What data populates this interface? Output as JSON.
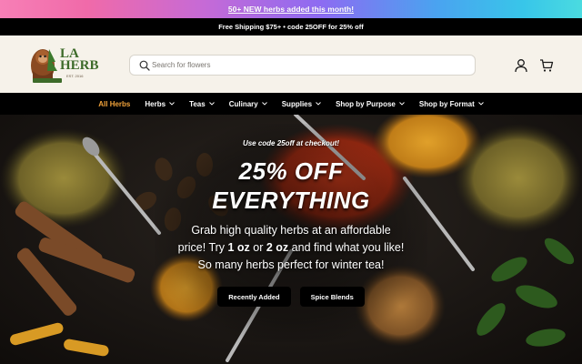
{
  "promo": {
    "text": "50+ NEW herbs added this month!"
  },
  "shipping": {
    "text": "Free Shipping $75+ • code 25OFF for 25% off"
  },
  "logo": {
    "line1": "LA",
    "line2": "HERB",
    "tag": "EST. 2016"
  },
  "search": {
    "placeholder": "Search for flowers"
  },
  "nav": {
    "items": [
      {
        "label": "All Herbs",
        "active": true,
        "dropdown": false
      },
      {
        "label": "Herbs",
        "active": false,
        "dropdown": true
      },
      {
        "label": "Teas",
        "active": false,
        "dropdown": true
      },
      {
        "label": "Culinary",
        "active": false,
        "dropdown": true
      },
      {
        "label": "Supplies",
        "active": false,
        "dropdown": true
      },
      {
        "label": "Shop by Purpose",
        "active": false,
        "dropdown": true
      },
      {
        "label": "Shop by Format",
        "active": false,
        "dropdown": true
      }
    ]
  },
  "hero": {
    "kicker": "Use code 25off at checkout!",
    "title_line1": "25% OFF",
    "title_line2": "EVERYTHING",
    "body_part1": "Grab high quality herbs at an affordable price! Try ",
    "body_bold1": "1 oz",
    "body_part2": " or ",
    "body_bold2": "2 oz",
    "body_part3": " and find what you like! So many herbs perfect for winter tea!",
    "button1": "Recently Added",
    "button2": "Spice Blends"
  },
  "colors": {
    "accent": "#f2a33a",
    "header_bg": "#f6f2ea",
    "nav_bg": "#000000"
  },
  "icons": {
    "search": "search-icon",
    "account": "account-icon",
    "cart": "cart-icon",
    "chevron": "chevron-down-icon"
  }
}
